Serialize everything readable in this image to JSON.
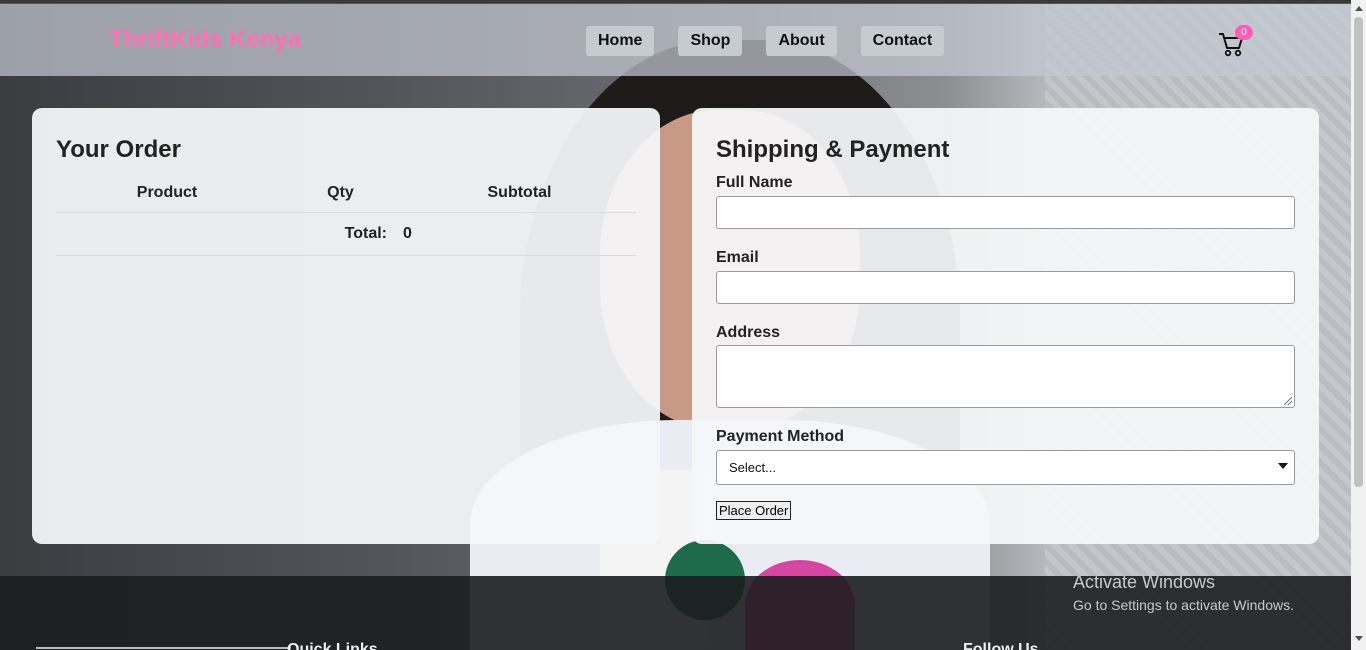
{
  "header": {
    "brand": "ThriftKids Kenya",
    "nav": [
      "Home",
      "Shop",
      "About",
      "Contact"
    ],
    "cart_icon": "cart-icon",
    "cart_count": "0"
  },
  "order": {
    "title": "Your Order",
    "columns": [
      "Product",
      "Qty",
      "Subtotal"
    ],
    "total_label": "Total:",
    "total_value": "0"
  },
  "shipping": {
    "title": "Shipping & Payment",
    "full_name_label": "Full Name",
    "full_name_value": "",
    "email_label": "Email",
    "email_value": "",
    "address_label": "Address",
    "address_value": "",
    "payment_label": "Payment Method",
    "payment_selected": "Select...",
    "place_order": "Place Order"
  },
  "footer": {
    "quick_links": "Quick Links",
    "follow_us": "Follow Us"
  },
  "os_overlay": {
    "title": "Activate Windows",
    "subtitle": "Go to Settings to activate Windows."
  },
  "colors": {
    "brand": "#ff6fb5",
    "badge": "#ff5fb0",
    "footer": "#1c1d1f"
  }
}
